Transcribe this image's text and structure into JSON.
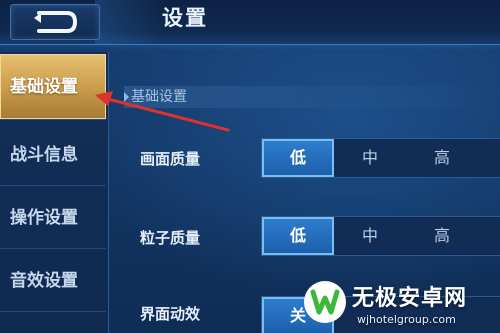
{
  "header": {
    "title": "设置"
  },
  "sidebar": {
    "items": [
      {
        "label": "基础设置",
        "active": true
      },
      {
        "label": "战斗信息",
        "active": false
      },
      {
        "label": "操作设置",
        "active": false
      },
      {
        "label": "音效设置",
        "active": false
      }
    ]
  },
  "section": {
    "title": "基础设置"
  },
  "settings": [
    {
      "label": "画面质量",
      "options": [
        "低",
        "中",
        "高"
      ],
      "selected": "低"
    },
    {
      "label": "粒子质量",
      "options": [
        "低",
        "中",
        "高"
      ],
      "selected": "低"
    },
    {
      "label": "界面动效",
      "options": [
        "关"
      ],
      "selected": "关"
    }
  ],
  "watermark": {
    "name": "无极安卓网",
    "url": "wjhotelgroup.com"
  },
  "colors": {
    "accent_active_tab": "#d3a85a",
    "selected_option": "#2a74c4",
    "annotation_arrow": "#e0322c",
    "watermark_green": "#3cb93a"
  }
}
